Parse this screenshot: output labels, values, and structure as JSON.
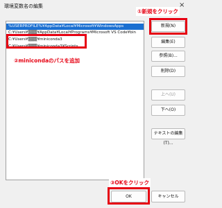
{
  "window": {
    "title": "環境変数名の編集",
    "close_glyph": "×"
  },
  "list": {
    "items": [
      "%USERPROFILE%¥AppData¥Local¥Microsoft¥WindowsApps",
      "C:¥Users¥▒▒▒¥AppData¥Local¥Programs¥Microsoft VS Code¥bin",
      "C:¥Users¥▒▒▒¥miniconda3",
      "C:¥Users¥▒▒▒¥miniconda3¥Scripts"
    ],
    "selected_index": 0
  },
  "buttons": {
    "new": "新規(N)",
    "edit": "編集(E)",
    "browse": "参照(B)...",
    "delete": "削除(D)",
    "up": "上へ(U)",
    "down": "下へ(O)",
    "edit_text": "テキストの編集(T)...",
    "ok": "OK",
    "cancel": "キャンセル"
  },
  "annotations": {
    "step1": "①新規をクリック",
    "step2": "②minicondaのパスを追加",
    "step3": "③OKをクリック",
    "color": "#e60012"
  }
}
